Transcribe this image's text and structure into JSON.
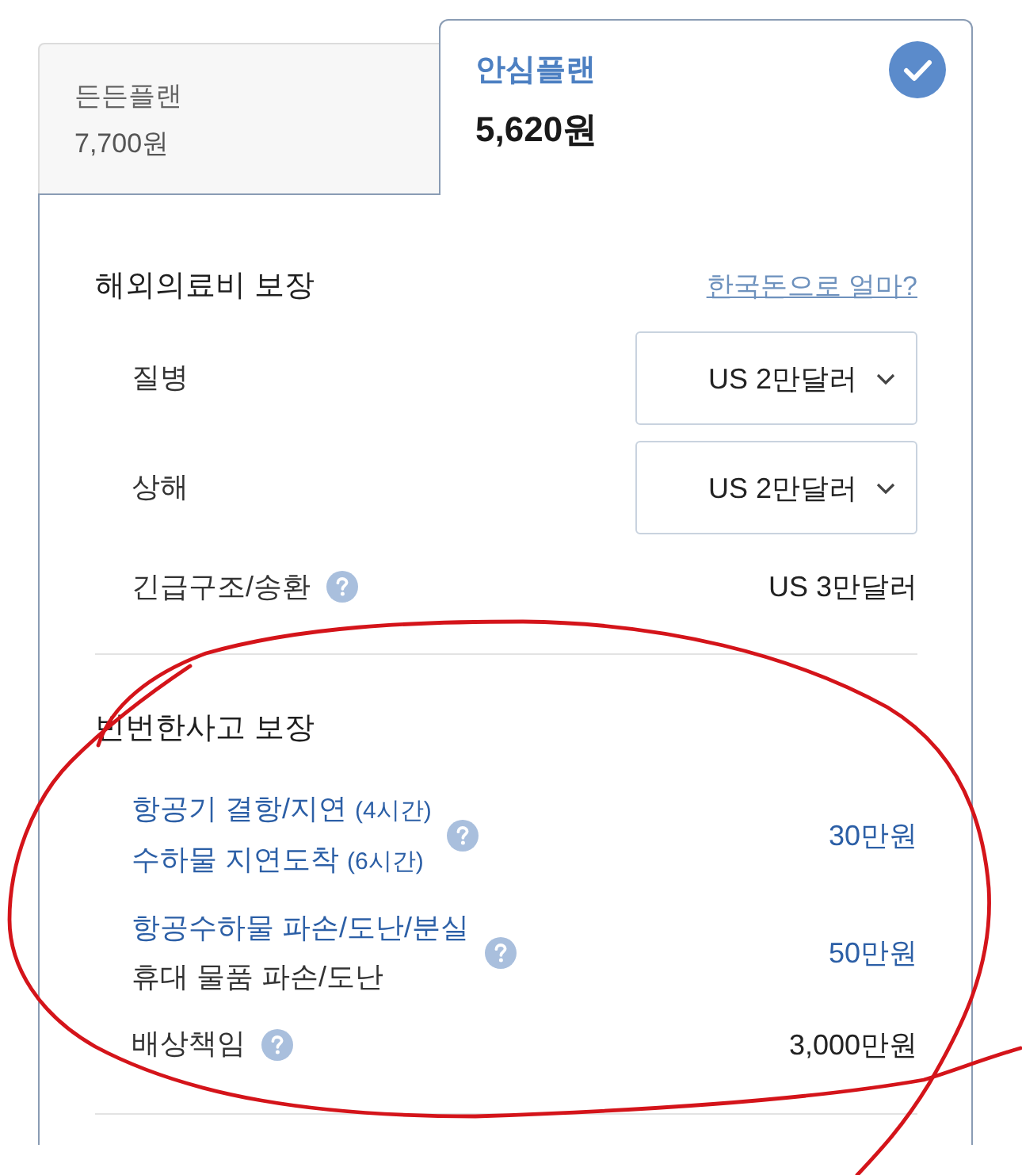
{
  "plans": [
    {
      "name": "든든플랜",
      "price": "7,700원",
      "selected": false
    },
    {
      "name": "안심플랜",
      "price": "5,620원",
      "selected": true
    }
  ],
  "sections": [
    {
      "title": "해외의료비 보장",
      "link": "한국돈으로 얼마?",
      "rows": [
        {
          "kind": "select",
          "lines": [
            {
              "text": "질병",
              "highlighted": false
            }
          ],
          "help": false,
          "value": "US 2만달러",
          "highlighted": false
        },
        {
          "kind": "select",
          "lines": [
            {
              "text": "상해",
              "highlighted": false
            }
          ],
          "help": false,
          "value": "US 2만달러",
          "highlighted": false
        },
        {
          "kind": "plain",
          "lines": [
            {
              "text": "긴급구조/송환",
              "highlighted": false
            }
          ],
          "help": true,
          "value": "US 3만달러",
          "highlighted": false
        }
      ]
    },
    {
      "title": "빈번한사고 보장",
      "rows": [
        {
          "kind": "plain",
          "lines": [
            {
              "text": "항공기 결항/지연",
              "note": "(4시간)",
              "highlighted": true
            },
            {
              "text": "수하물 지연도착",
              "note": "(6시간)",
              "highlighted": true
            }
          ],
          "help": true,
          "value": "30만원",
          "highlighted": true
        },
        {
          "kind": "plain",
          "lines": [
            {
              "text": "항공수하물 파손/도난/분실",
              "highlighted": true
            },
            {
              "text": "휴대 물품 파손/도난",
              "highlighted": false
            }
          ],
          "help": true,
          "value": "50만원",
          "highlighted": true
        },
        {
          "kind": "plain",
          "lines": [
            {
              "text": "배상책임",
              "highlighted": false
            }
          ],
          "help": true,
          "value": "3,000만원",
          "highlighted": false
        }
      ]
    }
  ],
  "annotation": {
    "kind": "freehand-ellipse"
  }
}
